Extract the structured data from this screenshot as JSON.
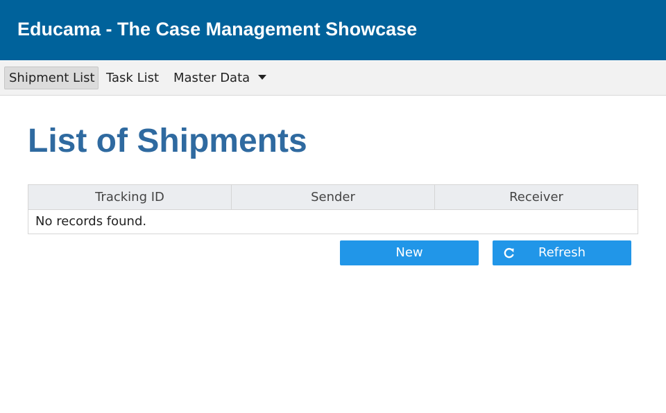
{
  "header": {
    "title": "Educama - The Case Management Showcase"
  },
  "menu": {
    "items": [
      {
        "label": "Shipment List",
        "active": true
      },
      {
        "label": "Task List",
        "active": false
      },
      {
        "label": "Master Data",
        "active": false,
        "dropdown": true
      }
    ]
  },
  "main": {
    "title": "List of Shipments",
    "table": {
      "columns": [
        "Tracking ID",
        "Sender",
        "Receiver"
      ],
      "empty_message": "No records found."
    },
    "buttons": {
      "new_label": "New",
      "refresh_label": "Refresh",
      "refresh_icon": "refresh-icon"
    }
  },
  "colors": {
    "header_bg": "#00629b",
    "title_color": "#2f6aa0",
    "button_bg": "#2196e8"
  }
}
